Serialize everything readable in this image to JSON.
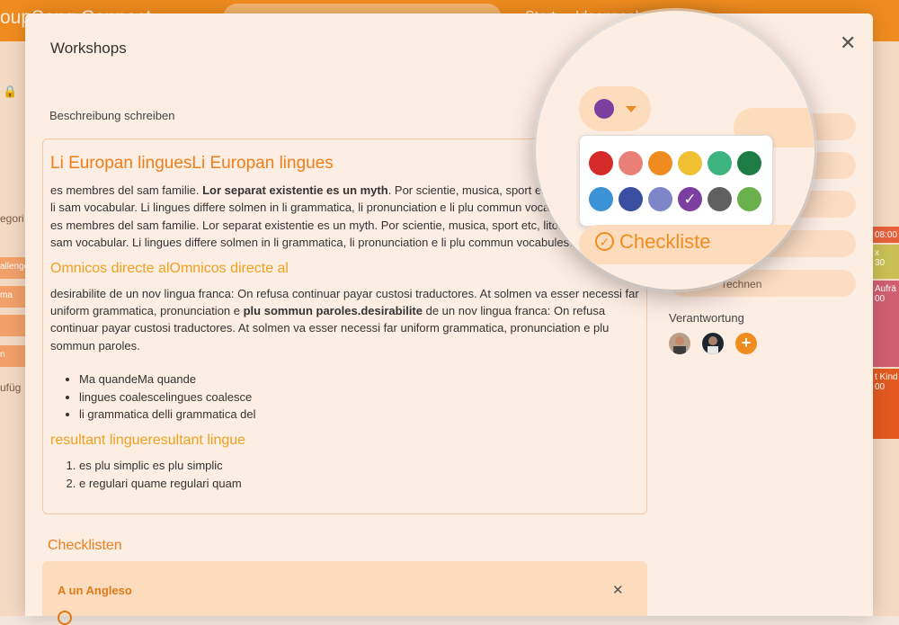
{
  "app": {
    "brand": "oupSong Connect",
    "nav_start": "Start",
    "nav_ideas": "Ideenpool",
    "left_fragments": [
      "egori",
      "allenge",
      "ma",
      "n",
      "ufüg"
    ],
    "calendar": [
      {
        "time": "08:00",
        "label": "",
        "color": "#e8603a"
      },
      {
        "time": "30",
        "label": "x",
        "color": "#c9c055"
      },
      {
        "time": "00",
        "label": "Aufrä",
        "color": "#d06070"
      },
      {
        "time": "00",
        "label": "t Kind",
        "color": "#e35a20"
      }
    ]
  },
  "modal": {
    "title": "Workshops",
    "close_icon": "close-icon",
    "description_label": "Beschreibung schreiben",
    "editor": {
      "h2": "Li Europan linguesLi Europan lingues",
      "p1_a": "es membres del sam familie. ",
      "p1_bold": "Lor separat existentie es un myth",
      "p1_b": ". Por scientie, musica, sport etc, litot Europa usa li sam vocabular. Li lingues differe solmen in li grammatica, li pronunciation e li plu commun vocabules.\n es membres del sam familie. Lor separat existentie es un myth. Por scientie, musica, sport etc, litot Europa usa li sam vocabular. Li lingues differe solmen in li grammatica, li pronunciation e li plu commun vocabules.",
      "h3": "Omnicos directe alOmnicos directe al",
      "p2_a": "desirabilite de un nov lingua franca: On refusa continuar payar custosi traductores. At solmen va esser necessi far uniform grammatica, pronunciation e ",
      "p2_bold": "plu sommun paroles.desirabilite",
      "p2_b": " de un nov lingua franca: On refusa continuar payar custosi traductores. At solmen va esser necessi far uniform grammatica, pronunciation e plu sommun paroles.",
      "bullets": [
        "Ma quandeMa quande",
        "lingues coalescelingues coalesce",
        "li grammatica delli grammatica del"
      ],
      "h3b": "resultant lingueresultant lingue",
      "numbered": [
        "es plu simplic es plu simplic",
        "e regulari quame regulari quam"
      ]
    },
    "checklists_title": "Checklisten",
    "checklist": {
      "name": "A un Angleso",
      "close_icon": "close-icon"
    },
    "responsibility_label": "Verantwortung",
    "side_fragment": "rechnen",
    "add_icon": "plus-icon"
  },
  "magnifier": {
    "selected_color": "#7b3fa0",
    "colors": [
      "#d42a2a",
      "#e88078",
      "#f08c1f",
      "#f2c033",
      "#3db37f",
      "#1e7d44",
      "#3b93d6",
      "#3a4fa0",
      "#7c86c8",
      "#7b3fa0",
      "#606060",
      "#6ab04c"
    ],
    "checked_index": 9,
    "checklist_label": "Checkliste",
    "checklist_icon": "check-circle-icon"
  }
}
